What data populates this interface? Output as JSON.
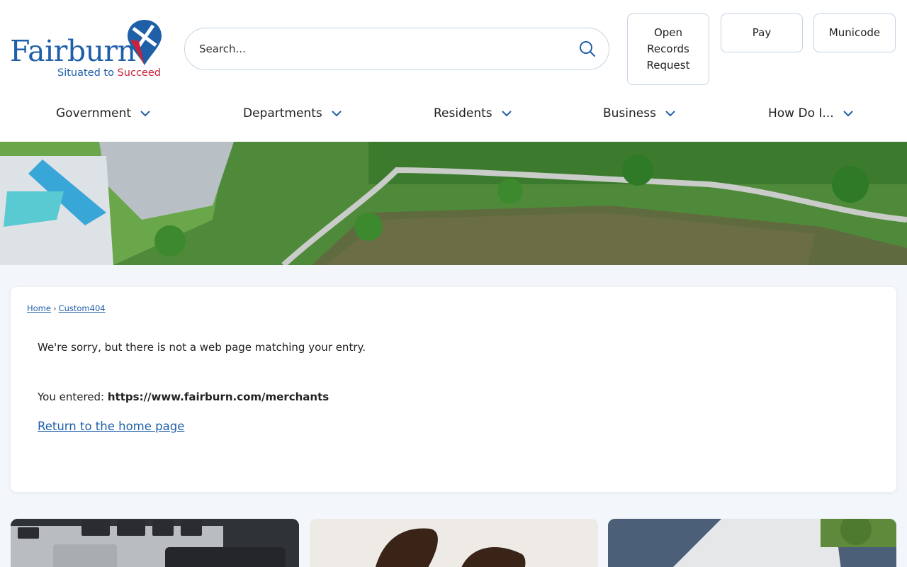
{
  "logo": {
    "wordmark": "Fairburn",
    "tagline_main": "Situated to ",
    "tagline_accent": "Succeed",
    "brand_color": "#1f5fa8",
    "accent_color": "#c8233a"
  },
  "search": {
    "placeholder": "Search...",
    "icon": "search-icon"
  },
  "quick_links": {
    "records": "Open Records Request",
    "pay": "Pay",
    "municode": "Municode"
  },
  "nav": {
    "government": "Government",
    "departments": "Departments",
    "residents": "Residents",
    "business": "Business",
    "how_do_i": "How Do I..."
  },
  "breadcrumb": {
    "home": "Home",
    "separator": "›",
    "current": "Custom404"
  },
  "error": {
    "message": "We're sorry, but there is not a web page matching your entry.",
    "entered_label": "You entered: ",
    "entered_url": "https://www.fairburn.com/merchants",
    "return_link": "Return to the home page"
  }
}
